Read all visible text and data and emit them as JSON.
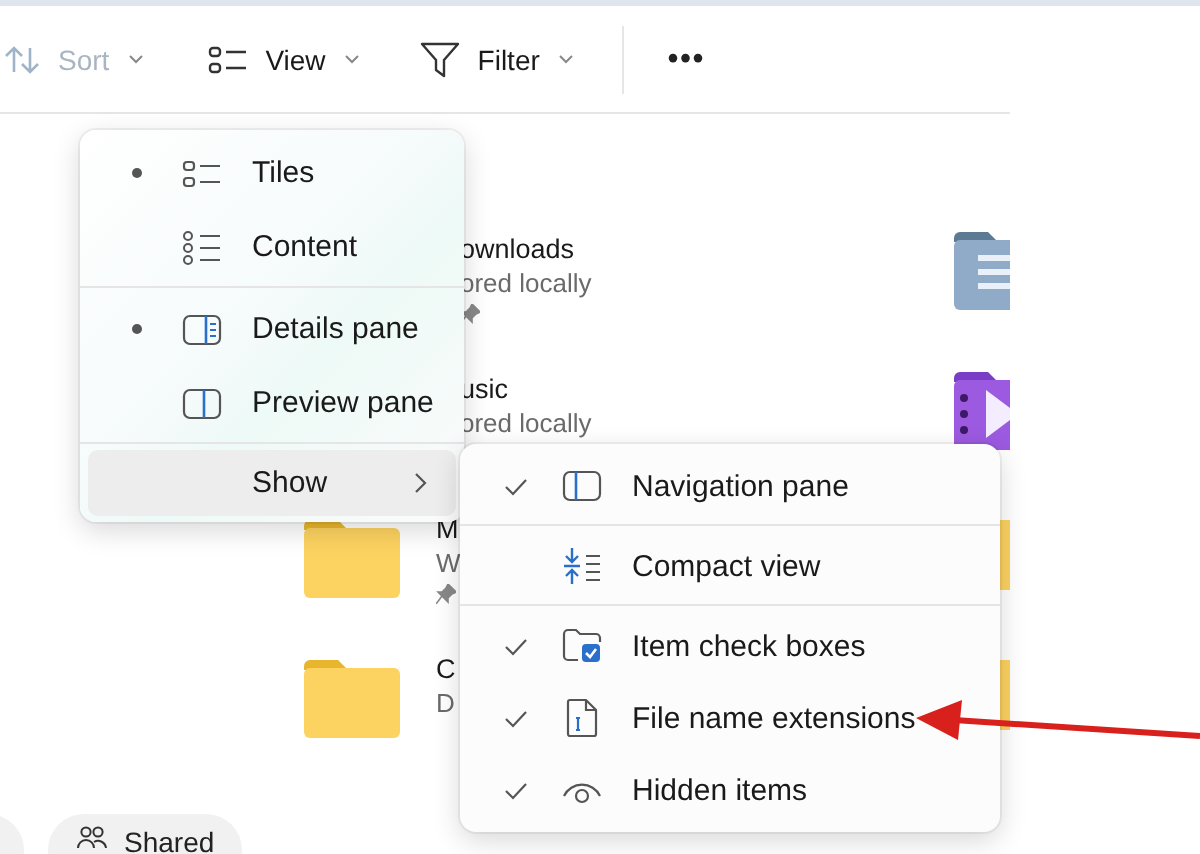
{
  "toolbar": {
    "items": [
      {
        "label": "Sort",
        "kind": "sort",
        "disabled": true
      },
      {
        "label": "View",
        "kind": "view",
        "disabled": false
      },
      {
        "label": "Filter",
        "kind": "filter",
        "disabled": false
      }
    ],
    "more": "•••"
  },
  "tiles": [
    {
      "name": "ownloads",
      "detail": "ored locally",
      "kind": "covered",
      "pinned": true
    },
    {
      "name": "usic",
      "detail": "ored locally",
      "kind": "covered",
      "pinned": false
    },
    {
      "name": "M",
      "detail": "W",
      "kind": "folder",
      "pinned": true
    },
    {
      "name": "C",
      "detail": "D",
      "kind": "folder",
      "pinned": false
    }
  ],
  "right_tiles": [
    {
      "kind": "documents"
    },
    {
      "kind": "videos"
    },
    {
      "kind": "folder"
    },
    {
      "kind": "folder"
    }
  ],
  "chips": [
    {
      "kind": "partial"
    },
    {
      "kind": "chip",
      "label": "Shared"
    }
  ],
  "view_menu": {
    "groups": [
      [
        {
          "label": "Tiles",
          "kind": "tiles",
          "selected": true
        },
        {
          "label": "Content",
          "kind": "content",
          "selected": false
        }
      ],
      [
        {
          "label": "Details pane",
          "kind": "details",
          "selected": true
        },
        {
          "label": "Preview pane",
          "kind": "preview",
          "selected": false
        }
      ]
    ],
    "show": {
      "label": "Show",
      "expanded": true
    }
  },
  "show_menu": {
    "groups": [
      [
        {
          "label": "Navigation pane",
          "kind": "navigation",
          "checked": true
        }
      ],
      [
        {
          "label": "Compact view",
          "kind": "compact",
          "checked": false
        }
      ],
      [
        {
          "label": "Item check boxes",
          "kind": "checkboxes",
          "checked": true
        },
        {
          "label": "File name extensions",
          "kind": "extensions",
          "checked": true
        },
        {
          "label": "Hidden items",
          "kind": "hidden",
          "checked": true
        }
      ]
    ]
  }
}
